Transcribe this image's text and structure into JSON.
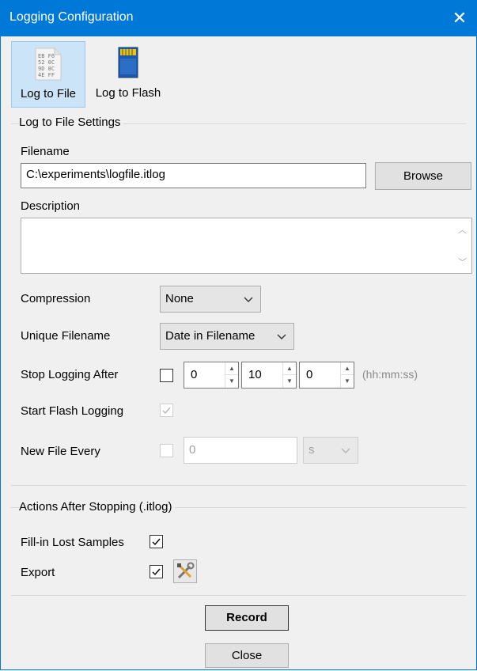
{
  "window": {
    "title": "Logging Configuration"
  },
  "tabs": [
    {
      "label": "Log to File",
      "selected": true,
      "icon": "hex-file-icon"
    },
    {
      "label": "Log to Flash",
      "selected": false,
      "icon": "sd-card-icon"
    }
  ],
  "file_settings": {
    "group_title": "Log to File Settings",
    "filename_label": "Filename",
    "filename_value": "C:\\experiments\\logfile.itlog",
    "browse_label": "Browse",
    "description_label": "Description",
    "description_value": "",
    "compression_label": "Compression",
    "compression_value": "None",
    "unique_label": "Unique Filename",
    "unique_value": "Date in Filename",
    "stop_label": "Stop Logging After",
    "stop_checked": false,
    "stop_hours": "0",
    "stop_minutes": "10",
    "stop_seconds": "0",
    "stop_format": "(hh:mm:ss)",
    "flash_label": "Start Flash Logging",
    "flash_checked": true,
    "newfile_label": "New File Every",
    "newfile_checked": false,
    "newfile_value": "0",
    "newfile_unit": "s"
  },
  "actions": {
    "group_title": "Actions After Stopping (.itlog)",
    "fill_label": "Fill-in Lost Samples",
    "fill_checked": true,
    "export_label": "Export",
    "export_checked": true
  },
  "footer": {
    "record_label": "Record",
    "close_label": "Close"
  },
  "colors": {
    "accent": "#0078d7",
    "background": "#f0f0f0"
  }
}
